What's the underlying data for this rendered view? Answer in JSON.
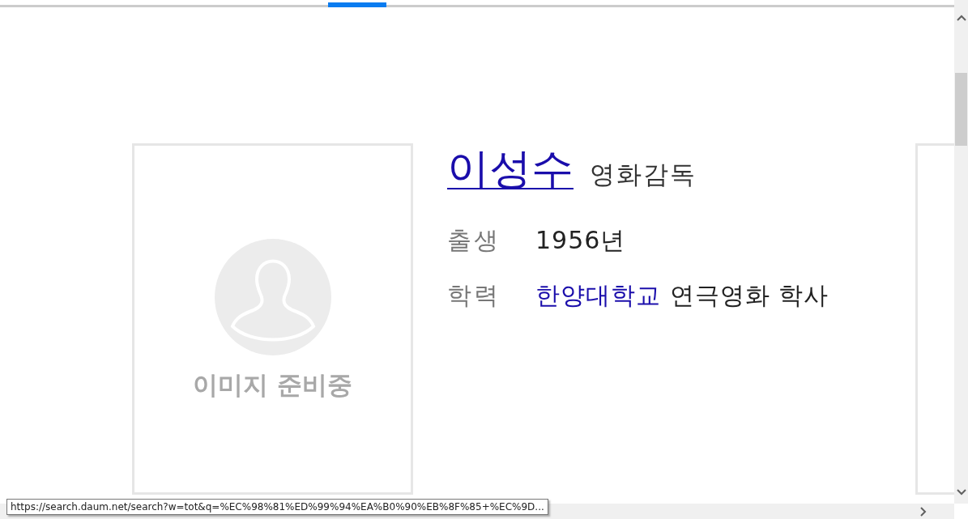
{
  "profile": {
    "image_caption": "이미지 준비중",
    "name": "이성수",
    "role": "영화감독",
    "facts": [
      {
        "label": "출생",
        "value": [
          {
            "kind": "plain",
            "text": "1956년"
          }
        ]
      },
      {
        "label": "학력",
        "value": [
          {
            "kind": "link",
            "text": "한양대학교"
          },
          {
            "kind": "plain",
            "text": "연극영화 학사"
          }
        ]
      }
    ]
  },
  "status_url": "https://search.daum.net/search?w=tot&q=%EC%98%81%ED%99%94%EA%B0%90%EB%8F%85+%EC%9D..."
}
